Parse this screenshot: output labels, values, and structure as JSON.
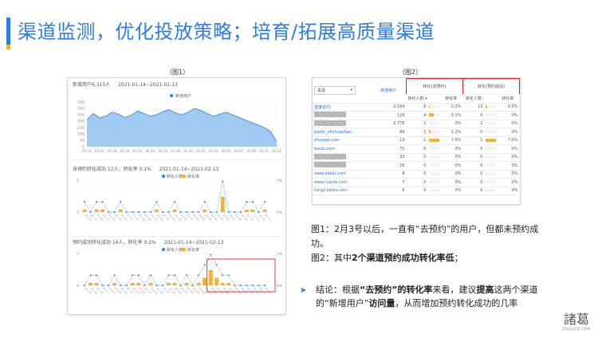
{
  "slide": {
    "title": "渠道监测，优化投放策略；培育/拓展高质量渠道",
    "fig1_caption": "（图1）",
    "fig2_caption": "（图2）"
  },
  "colors": {
    "accent": "#2f7de1",
    "bar": "#f2b233",
    "line": "#2f7de1",
    "highlight_box": "#d9262c"
  },
  "fig1": {
    "chart1": {
      "head_label": "新增用户6,315人",
      "head_date": "2021-01-14~2021-02-13",
      "legend": "新增用户"
    },
    "chart2": {
      "head_label": "去预约转化成功 12人，转化率 0.1%",
      "head_date": "2021-01-14~2021-02-13",
      "legend_a": "转化人数",
      "legend_b": "转化率"
    },
    "chart3": {
      "head_label": "预约成功转化成功 16人，转化率 0.2%",
      "head_date": "2021-01-14~2021-02-13",
      "legend_a": "转化人数",
      "legend_b": "转化率"
    }
  },
  "fig2": {
    "select_value": "来源",
    "col_new_users": "新增用户",
    "group_a": "转化(去预约)",
    "group_b": "转化(预约成功)",
    "sub_count": "转化人数",
    "sub_rate": "转化率",
    "rows": [
      {
        "source": "直接访问",
        "blur": false,
        "new_users": "2,164",
        "a_count": "6",
        "a_rate": "0.2%",
        "a_fill": 0.2,
        "b_count": "13",
        "b_rate": "0.6%",
        "b_fill": 0.6
      },
      {
        "source": "",
        "blur": true,
        "new_users": "126",
        "a_count": "4",
        "a_rate": "3.1%",
        "a_fill": 3.1,
        "b_count": "0",
        "b_rate": "0%",
        "b_fill": 0
      },
      {
        "source": "",
        "blur": true,
        "new_users": "3,776",
        "a_count": "1",
        "a_rate": "0%",
        "a_fill": 0,
        "b_count": "2",
        "b_rate": "0%",
        "b_fill": 0
      },
      {
        "source": "baidu_ohchuazhao",
        "blur": false,
        "new_users": "89",
        "a_count": "1",
        "a_rate": "1.1%",
        "a_fill": 1.1,
        "b_count": "0",
        "b_rate": "0%",
        "b_fill": 0
      },
      {
        "source": "zhuyaei.com",
        "blur": false,
        "new_users": "13",
        "a_count": "1",
        "a_rate": "7.6%",
        "a_fill": 7.6,
        "b_count": "1",
        "b_rate": "7.6%",
        "b_fill": 7.6
      },
      {
        "source": "baidu.com",
        "blur": false,
        "new_users": "71",
        "a_count": "0",
        "a_rate": "0%",
        "a_fill": 0,
        "b_count": "0",
        "b_rate": "0%",
        "b_fill": 0
      },
      {
        "source": "",
        "blur": true,
        "new_users": "32",
        "a_count": "0",
        "a_rate": "0%",
        "a_fill": 0,
        "b_count": "0",
        "b_rate": "0%",
        "b_fill": 0
      },
      {
        "source": "",
        "blur": true,
        "new_users": "16",
        "a_count": "0",
        "a_rate": "0%",
        "a_fill": 0,
        "b_count": "0",
        "b_rate": "0%",
        "b_fill": 0
      },
      {
        "source": "www.baidu.com",
        "blur": false,
        "new_users": "8",
        "a_count": "0",
        "a_rate": "0%",
        "a_fill": 0,
        "b_count": "0",
        "b_rate": "0%",
        "b_fill": 0
      },
      {
        "source": "www.ruanle.com",
        "blur": false,
        "new_users": "7",
        "a_count": "0",
        "a_rate": "0%",
        "a_fill": 0,
        "b_count": "0",
        "b_rate": "0%",
        "b_fill": 0
      },
      {
        "source": "tongji.baidu.com",
        "blur": false,
        "new_users": "6",
        "a_count": "0",
        "a_rate": "0%",
        "a_fill": 0,
        "b_count": "0",
        "b_rate": "0%",
        "b_fill": 0
      }
    ]
  },
  "notes": {
    "n1": "图1：2月3号以后，一直有“去预约”的用户，但都未预约成功。",
    "n2_a": "图2：其中",
    "n2_b": "2个渠道预约成功转化率低",
    "n2_c": "；"
  },
  "conclusion": {
    "arrow": "➤",
    "p1": "结论：根据",
    "p2": "“去预约”的转化率",
    "p3": "来看，建议",
    "p4": "提高",
    "p5": "这两个渠道的“新增用户”",
    "p6": "访问量",
    "p7": "，从而增加预约转化成功的几率"
  },
  "logo": {
    "main": "諸葛",
    "sub": "ZHUGEIO.COM"
  },
  "chart_data": [
    {
      "type": "area",
      "series": [
        {
          "name": "新增用户",
          "values": [
            210,
            260,
            225,
            240,
            270,
            255,
            230,
            245,
            280,
            260,
            240,
            250,
            275,
            290,
            265,
            250,
            270,
            300,
            285,
            260,
            240,
            255,
            270,
            250,
            230,
            210,
            190,
            170,
            150,
            120,
            40
          ]
        }
      ],
      "x": [
        "01-14",
        "01-16",
        "01-18",
        "01-20",
        "01-22",
        "01-24",
        "01-26",
        "01-28",
        "01-30",
        "02-01",
        "02-03",
        "02-05",
        "02-07",
        "02-09",
        "02-11",
        "02-13"
      ],
      "y_ticks": [
        "0",
        "50",
        "100",
        "150",
        "200",
        "250",
        "300",
        "350"
      ],
      "ylim": [
        0,
        350
      ]
    },
    {
      "type": "bar",
      "series": [
        {
          "name": "转化人数",
          "values": [
            1,
            0,
            1,
            1,
            0,
            0,
            1,
            0,
            0,
            0,
            0,
            0,
            1,
            0,
            0,
            1,
            0,
            0,
            0,
            0,
            1,
            0,
            0,
            3,
            0,
            0,
            0,
            1,
            1,
            0,
            1
          ]
        },
        {
          "name": "转化率",
          "values": [
            0.1,
            0,
            0.1,
            0.1,
            0,
            0,
            0.1,
            0,
            0,
            0,
            0,
            0,
            0.1,
            0,
            0,
            0.1,
            0,
            0,
            0,
            0,
            0.1,
            0,
            0,
            0.6,
            0,
            0,
            0,
            0.1,
            0.1,
            0,
            0.1
          ]
        }
      ],
      "y_left_ticks": [
        "0",
        "5"
      ],
      "y_right_ticks": [
        "0%",
        "2%"
      ]
    },
    {
      "type": "bar",
      "series": [
        {
          "name": "转化人数",
          "values": [
            0,
            1,
            1,
            0,
            0,
            1,
            0,
            0,
            1,
            1,
            0,
            1,
            0,
            0,
            1,
            1,
            0,
            1,
            0,
            1,
            2,
            3,
            2,
            1,
            1,
            0,
            0,
            0,
            0,
            0,
            0
          ]
        },
        {
          "name": "转化率",
          "values": [
            0,
            0.1,
            0.1,
            0,
            0,
            0.1,
            0,
            0,
            0.1,
            0.1,
            0,
            0.1,
            0,
            0,
            0.1,
            0.1,
            0,
            0.1,
            0,
            0.1,
            0.3,
            0.6,
            0.3,
            0.1,
            0.1,
            0,
            0,
            0,
            0,
            0,
            0
          ]
        }
      ],
      "y_left_ticks": [
        "0",
        "5"
      ],
      "y_right_ticks": [
        "0%",
        "2%"
      ]
    }
  ]
}
